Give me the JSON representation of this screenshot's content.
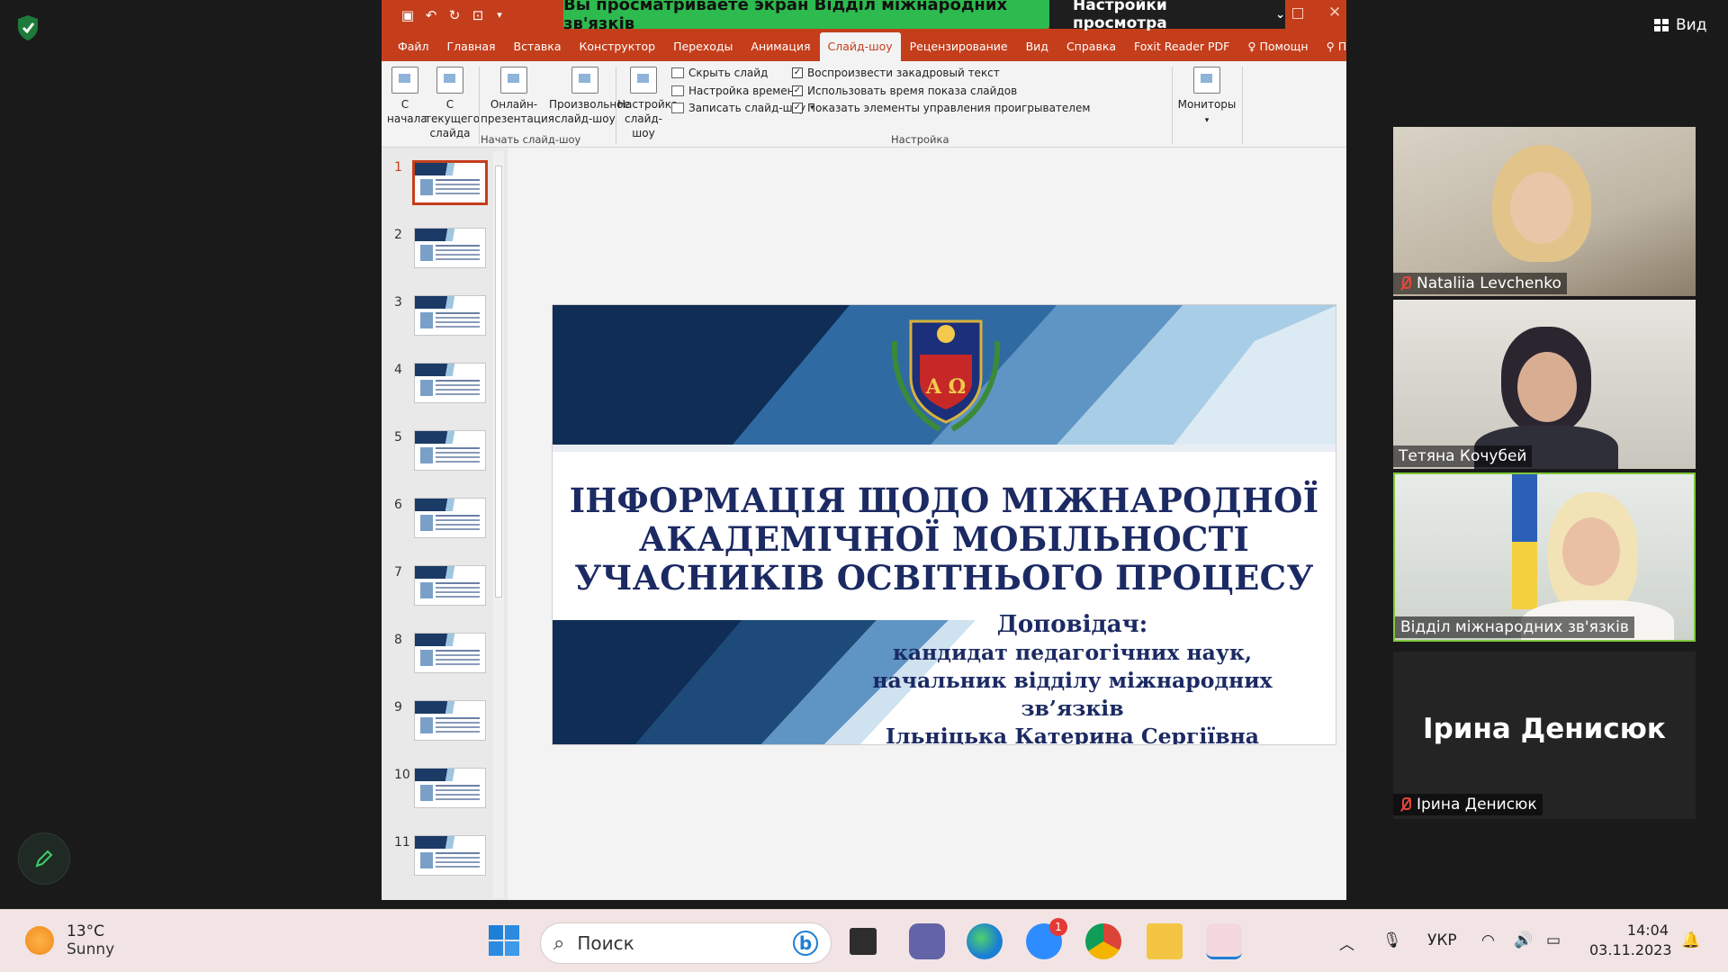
{
  "powerpoint": {
    "share_banner": "Вы просматриваете экран Відділ міжнародних зв'язків",
    "view_settings": "Настройки просмотра",
    "tabs": [
      "Файл",
      "Главная",
      "Вставка",
      "Конструктор",
      "Переходы",
      "Анимация",
      "Слайд-шоу",
      "Рецензирование",
      "Вид",
      "Справка",
      "Foxit Reader PDF",
      "Помощн",
      "Поделиться"
    ],
    "ribbon": {
      "from_start": "С начала",
      "from_current": "С текущего слайда",
      "online": "Онлайн-презентация",
      "custom": "Произвольное слайд-шоу",
      "group_start": "Начать слайд-шоу",
      "setup": "Настройка слайд-шоу",
      "hide_slide": "Скрыть слайд",
      "rehearse": "Настройка времени",
      "record": "Записать слайд-шоу",
      "play_narration": "Воспроизвести закадровый текст",
      "use_timings": "Использовать время показа слайдов",
      "show_controls": "Показать элементы управления проигрывателем",
      "group_setup": "Настройка",
      "monitors": "Мониторы"
    },
    "thumbnails": [
      "1",
      "2",
      "3",
      "4",
      "5",
      "6",
      "7",
      "8",
      "9",
      "10",
      "11"
    ],
    "selected_slide": 1,
    "slide": {
      "title_line1": "ІНФОРМАЦІЯ ЩОДО МІЖНАРОДНОЇ",
      "title_line2": "АКАДЕМІЧНОЇ МОБІЛЬНОСТІ",
      "title_line3": "УЧАСНИКІВ ОСВІТНЬОГО ПРОЦЕСУ",
      "speaker_label": "Доповідач:",
      "speaker_line1": "кандидат педагогічних наук,",
      "speaker_line2": "начальник відділу міжнародних зв’язків",
      "speaker_line3": "Ільніцька Катерина Сергіївна"
    }
  },
  "zoom": {
    "view_label": "Вид",
    "participants": [
      {
        "name": "Nataliia Levchenko",
        "muted": true
      },
      {
        "name": "Тетяна Кочубей",
        "muted": false
      },
      {
        "name": "Відділ міжнародних зв'язків",
        "muted": false,
        "speaking": true
      },
      {
        "name": "Ірина Денисюк",
        "muted": true
      }
    ]
  },
  "taskbar": {
    "weather_temp": "13°C",
    "weather_desc": "Sunny",
    "search_placeholder": "Поиск",
    "zoom_badge": "1",
    "language": "УКР",
    "time": "14:04",
    "date": "03.11.2023"
  },
  "colors": {
    "ppt_accent": "#c43e1c",
    "share_green": "#2dba4e",
    "speaker_border": "#7ec83a",
    "slide_navy": "#1c2a63"
  }
}
